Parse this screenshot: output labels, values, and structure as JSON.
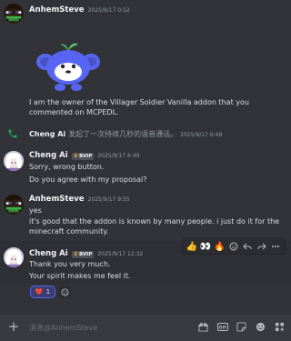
{
  "messages": {
    "m1": {
      "author": "AnhemSteve",
      "time": "2025/9/17 0:52",
      "text": "I am the owner of the Villager Soldier Vanilla addon that you commented on MCPEDL."
    },
    "call": {
      "author": "Cheng Ai",
      "text": "发起了一次持续几秒的语音通话。",
      "time": "2025/9/17 6:49"
    },
    "m2": {
      "author": "Cheng Ai",
      "badge": "BVIP",
      "time": "2025/9/17 6:49",
      "lines": [
        "Sorry, wrong button.",
        "Do you agree with my proposal?"
      ]
    },
    "m3": {
      "author": "AnhemSteve",
      "time": "2025/9/17 9:55",
      "lines": [
        "yes",
        "it's good that the addon is known by many people. i just do it for the minecraft community."
      ]
    },
    "m4": {
      "author": "Cheng Ai",
      "badge": "BVIP",
      "time": "2025/9/17 12:32",
      "lines": [
        "Thank you very much.",
        "Your spirit makes me feel it."
      ]
    }
  },
  "reaction": {
    "emoji": "❤️",
    "count": "1"
  },
  "toolbar": {
    "emojis": [
      "👍",
      "👀",
      "🔥"
    ]
  },
  "composer": {
    "placeholder": "消息@AnhemSteve"
  },
  "colors": {
    "background": "#313338",
    "accent": "#5865f2",
    "call_icon": "#23a55a"
  }
}
